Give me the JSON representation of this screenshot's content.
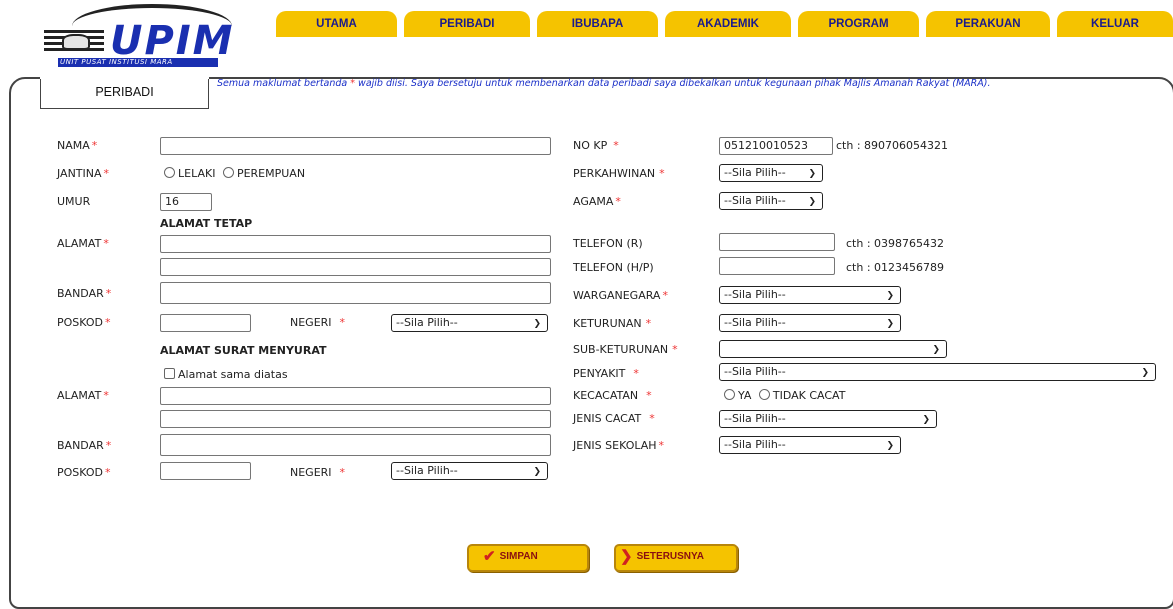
{
  "logo": {
    "text": "UPIM",
    "subtext": "UNIT PUSAT INSTITUSI MARA"
  },
  "nav": {
    "tabs": [
      "UTAMA",
      "PERIBADI",
      "IBUBAPA",
      "AKADEMIK",
      "PROGRAM",
      "PERAKUAN",
      "KELUAR"
    ]
  },
  "section_tab": "PERIBADI",
  "notice": {
    "before": "Semua maklumat bertanda ",
    "mark": "*",
    "after": " wajib diisi. Saya bersetuju untuk membenarkan data peribadi saya dibekalkan untuk kegunaan pihak Majlis Amanah Rakyat (MARA)."
  },
  "left": {
    "nama": "NAMA",
    "jantina": "JANTINA",
    "lelaki": "LELAKI",
    "perempuan": "PEREMPUAN",
    "umur": "UMUR",
    "umur_value": "16",
    "alamat_tetap": "ALAMAT TETAP",
    "alamat": "ALAMAT",
    "bandar": "BANDAR",
    "poskod": "POSKOD",
    "negeri": "NEGERI",
    "alamat_surat": "ALAMAT SURAT MENYURAT",
    "sama_diatas": "Alamat sama diatas",
    "alamat2": "ALAMAT",
    "bandar2": "BANDAR",
    "poskod2": "POSKOD",
    "negeri2": "NEGERI"
  },
  "right": {
    "no_kp": "NO KP",
    "no_kp_value": "051210010523",
    "no_kp_hint": "cth : 890706054321",
    "perkahwinan": "PERKAHWINAN",
    "agama": "AGAMA",
    "telefon_r": "TELEFON (R)",
    "telefon_r_hint": "cth : 0398765432",
    "telefon_hp": "TELEFON (H/P)",
    "telefon_hp_hint": "cth : 0123456789",
    "warganegara": "WARGANEGARA",
    "keturunan": "KETURUNAN",
    "sub_keturunan": "SUB-KETURUNAN",
    "penyakit": "PENYAKIT",
    "kecacatan": "KECACATAN",
    "ya": "YA",
    "tidak_cacat": "TIDAK CACAT",
    "jenis_cacat": "JENIS CACAT",
    "jenis_sekolah": "JENIS SEKOLAH"
  },
  "select_placeholder": "--Sila Pilih--",
  "buttons": {
    "simpan": "SIMPAN",
    "seterusnya": "SETERUSNYA"
  },
  "colors": {
    "tab": "#f5c300",
    "tab_text": "#1b1b8c",
    "required": "#e33333",
    "notice": "#1a2fc8"
  },
  "icons": {
    "simpan": "check-icon",
    "seterusnya": "arrow-right-icon"
  }
}
